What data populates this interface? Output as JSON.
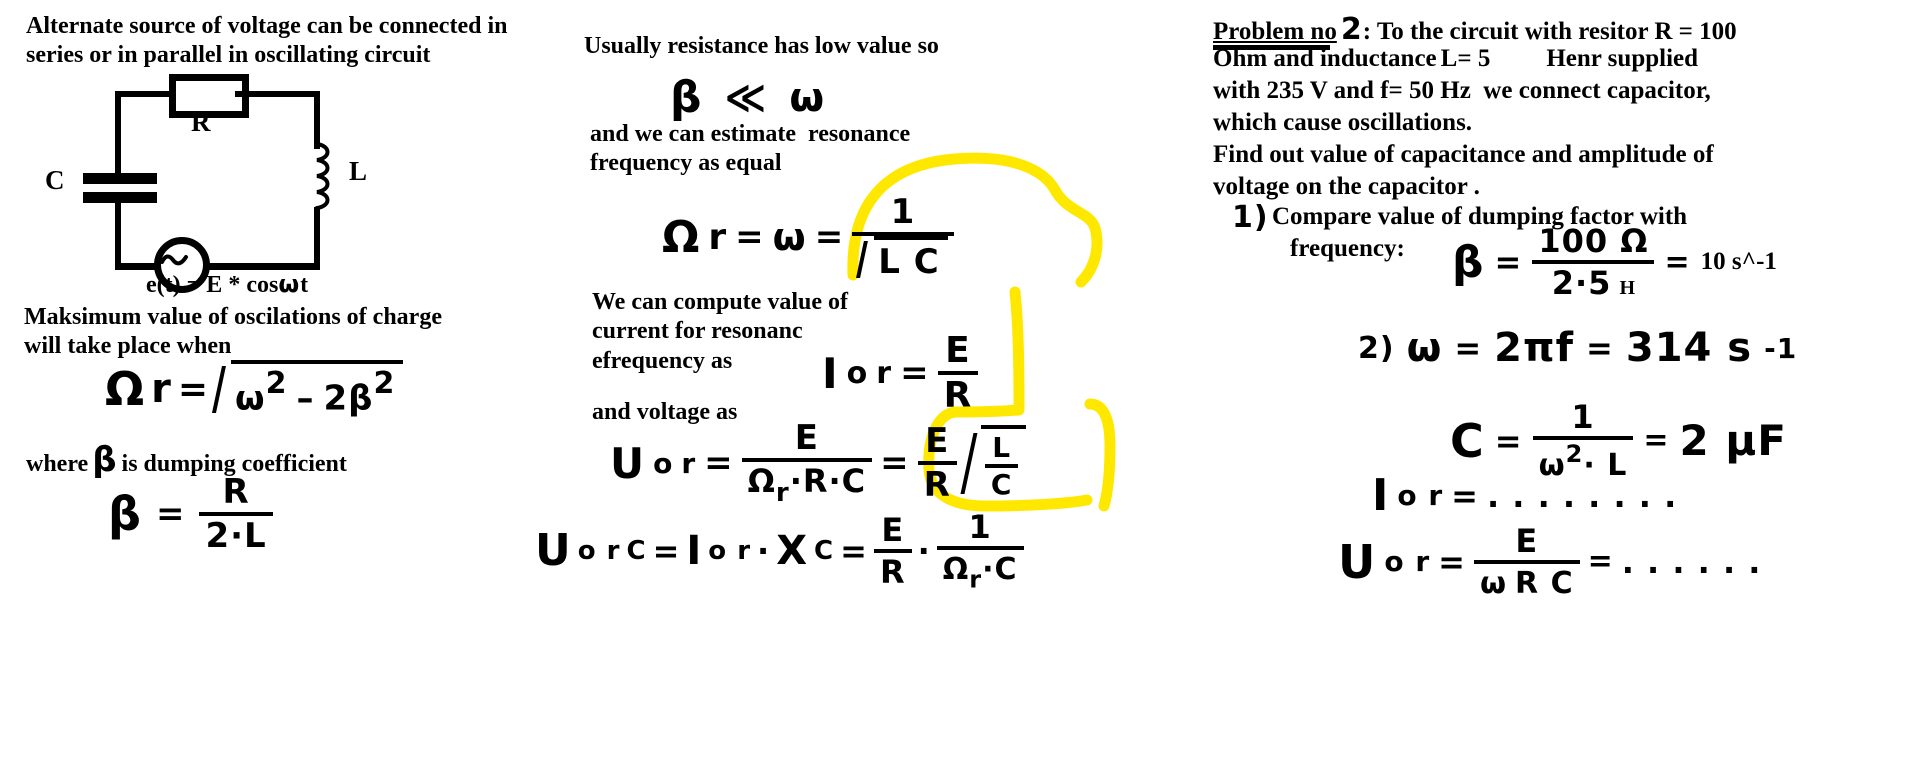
{
  "page": {
    "background": "#ffffff",
    "ink_color": "#000000",
    "marker_color": "#ffe800"
  },
  "left_column": {
    "intro_text": "Alternate source of voltage can be connected in series or in parallel in oscillating circuit",
    "circuit": {
      "resistor_label": "R",
      "inductor_label": "L",
      "capacitor_label": "C",
      "source_symbol": "~"
    },
    "source_equation": "e(t) = E * cos",
    "source_equation_omega": "ω",
    "source_equation_tail": "t",
    "max_value_text": "Maksimum value of oscilations of charge will take place when",
    "resonance_formula": {
      "omega_symbol": "Ω",
      "subscript": "r",
      "equals": "=",
      "radicand_omega": "ω",
      "radicand_omega_power": "2",
      "minus": "–",
      "radicand_two_beta": "2β",
      "radicand_beta_power": "2"
    },
    "damping_text_pre": "where",
    "damping_beta": "β",
    "damping_text_post": "is dumping coefficient",
    "beta_formula": {
      "lhs": "β",
      "equals": "=",
      "numerator": "R",
      "denominator": "2·L"
    }
  },
  "middle_column": {
    "low_resistance_text": "Usually resistance has low value so",
    "inequality": {
      "beta": "β",
      "relation": "≪",
      "omega": "ω"
    },
    "estimate_text": "and we can estimate  resonance frequency as equal",
    "resonance_equation": {
      "omega_r": "Ω",
      "subscript": "r",
      "eq1": "=",
      "omega": "ω",
      "eq2": "=",
      "numerator": "1",
      "sqrt_content": "L C"
    },
    "current_text": "We can compute value of current for resonanc efrequency as",
    "current_equation": {
      "lhs_I": "I",
      "lhs_sub": "o",
      "lhs_sub2": "r",
      "equals": "=",
      "numerator": "E",
      "denominator": "R"
    },
    "voltage_text": "and voltage as",
    "voltage_equation": {
      "lhs_U": "U",
      "lhs_sub": "o",
      "lhs_sub2": "r",
      "eq1": "=",
      "frac1_num": "E",
      "frac1_den": "Ω",
      "frac1_den_sub": "r",
      "frac1_den_rest": "·R·C",
      "eq2": "=",
      "frac2_num": "E",
      "frac2_den": "R",
      "sqrt_num": "L",
      "sqrt_den": "C"
    },
    "voltage_c_equation": {
      "lhs_U": "U",
      "lhs_sub": "o r",
      "lhs_sub_c": "C",
      "eq1": "=",
      "I_term": "I",
      "I_sub": "o r",
      "dot": "·",
      "X_term": "X",
      "X_sub": "C",
      "eq2": "=",
      "frac1_num": "E",
      "frac1_den": "R",
      "dot2": "·",
      "frac2_num": "1",
      "frac2_den": "Ω",
      "frac2_den_sub": "r",
      "frac2_den_rest": "·C"
    }
  },
  "right_column": {
    "problem_heading": "Problem no",
    "problem_number": "2",
    "problem_text": ": To the circuit with resitor R = 100 Ohm and inductance L= 5        Henr supplied with 235 V and f= 50 Hz  we connect capacitor, which cause oscillations.",
    "problem_text_line1": ": To the circuit with resitor R = 100",
    "problem_text_line2a": "Ohm and inductance",
    "problem_text_line2b": "L= 5",
    "problem_text_line2c": "Henr supplied",
    "problem_text_line3": "with 235 V and f= 50 Hz  we connect capacitor,",
    "problem_text_line4": "which cause oscillations.",
    "find_text_line1": "Find out value of capacitance and amplitude of",
    "find_text_line2": "voltage on the capacitor .",
    "step1": {
      "number": "1)",
      "text_line1": "Compare value of dumping factor with",
      "text_line2": "frequency:",
      "beta": "β",
      "equals": "=",
      "numerator": "100 Ω",
      "denominator": "2·5",
      "denominator_unit": "H",
      "result_eq": "=",
      "result": "10 s^-1"
    },
    "step2": {
      "number": "2)",
      "omega": "ω",
      "eq1": "=",
      "expr": "2πf",
      "eq2": "=",
      "result": "314 s",
      "result_sup": "-1"
    },
    "step3": {
      "lhs": "C",
      "equals": "=",
      "numerator": "1",
      "denominator_omega": "ω",
      "denominator_pow": "2",
      "denominator_rest": "· L",
      "result_eq": "=",
      "result": "2 μF"
    },
    "step4": {
      "lhs_I": "I",
      "lhs_sub": "o r",
      "equals": "=",
      "dots": ". . . . . . . ."
    },
    "step5": {
      "lhs_U": "U",
      "lhs_sub": "o r",
      "equals": "=",
      "frac_num": "E",
      "frac_den_omega": "ω",
      "frac_den_rest": "R C",
      "result_eq": "=",
      "dots": ". . . . . ."
    }
  }
}
